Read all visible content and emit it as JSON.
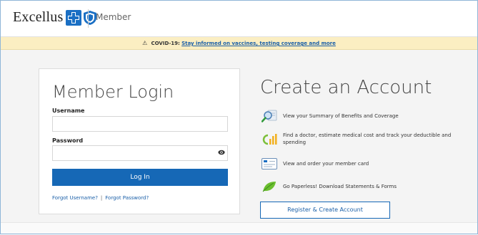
{
  "header": {
    "brand_name": "Excellus",
    "section_label": "Member"
  },
  "alert": {
    "prefix": "COVID-19:",
    "link_text": "Stay informed on vaccines, testing coverage and more"
  },
  "login": {
    "title": "Member Login",
    "username_label": "Username",
    "username_value": "",
    "password_label": "Password",
    "password_value": "",
    "submit_label": "Log In",
    "forgot_username": "Forgot Username?",
    "separator": "|",
    "forgot_password": "Forgot Password?"
  },
  "create": {
    "title": "Create an Account",
    "features": [
      {
        "icon": "magnifier-document-icon",
        "text": "View your Summary of Benefits and Coverage"
      },
      {
        "icon": "bar-chart-icon",
        "text": "Find a doctor, estimate medical cost and track your deductible and spending"
      },
      {
        "icon": "member-card-icon",
        "text": "View and order your member card"
      },
      {
        "icon": "leaf-icon",
        "text": "Go Paperless! Download Statements & Forms"
      }
    ],
    "register_label": "Register & Create Account"
  },
  "colors": {
    "primary_blue": "#1668b6",
    "alert_bg": "#fbeec2",
    "page_bg": "#f4f4f4"
  }
}
